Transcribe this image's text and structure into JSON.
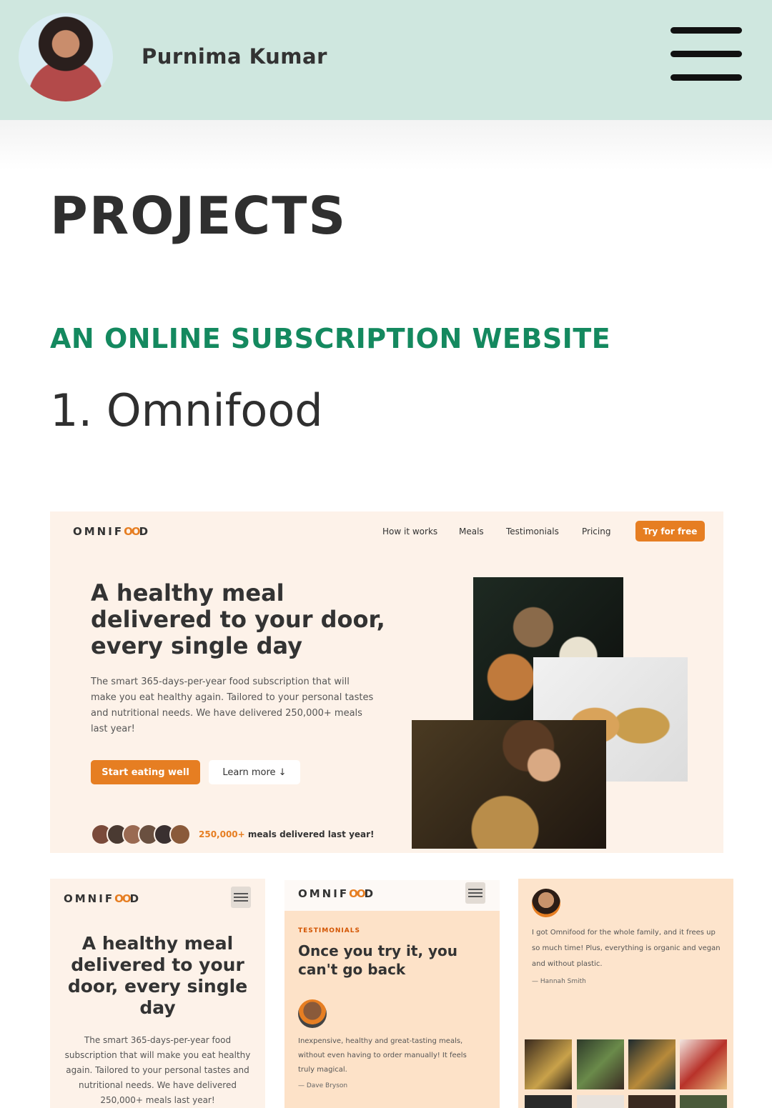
{
  "header": {
    "owner_name": "Purnima Kumar"
  },
  "page": {
    "heading": "PROJECTS",
    "project_tag": "AN ONLINE SUBSCRIPTION WEBSITE",
    "project_title": "1. Omnifood"
  },
  "omnifood": {
    "logo_left": "OMNIF",
    "logo_mark": "OO",
    "logo_right": "D",
    "nav": [
      "How it works",
      "Meals",
      "Testimonials",
      "Pricing"
    ],
    "cta": "Try for free",
    "hero_title": "A healthy meal delivered to your door, every single day",
    "hero_desc": "The smart 365-days-per-year food subscription that will make you eat healthy again. Tailored to your personal tastes and nutritional needs. We have delivered 250,000+ meals last year!",
    "btn_primary": "Start eating well",
    "btn_secondary": "Learn more ↓",
    "delivered_count": "250,000+",
    "delivered_text": " meals delivered last year!"
  },
  "mobile": {
    "hero_title": "A healthy meal delivered to your door, every single day",
    "hero_desc": "The smart 365-days-per-year food subscription that will make you eat healthy again. Tailored to your personal tastes and nutritional needs. We have delivered 250,000+ meals last year!",
    "testimonials_tag": "TESTIMONIALS",
    "testimonials_title": "Once you try it, you can't go back",
    "quote1": "Inexpensive, healthy and great-tasting meals, without even having to order manually! It feels truly magical.",
    "author1": "— Dave Bryson",
    "quote2": "I got Omnifood for the whole family, and it frees up so much time! Plus, everything is organic and vegan and without plastic.",
    "author2": "— Hannah Smith"
  },
  "colors": {
    "header_bg": "#cfe7df",
    "accent": "#e67e22",
    "tag_green": "#14895f",
    "preview_bg": "#fdf2e9"
  },
  "icons": [
    "menu-icon",
    "infinity-icon"
  ]
}
